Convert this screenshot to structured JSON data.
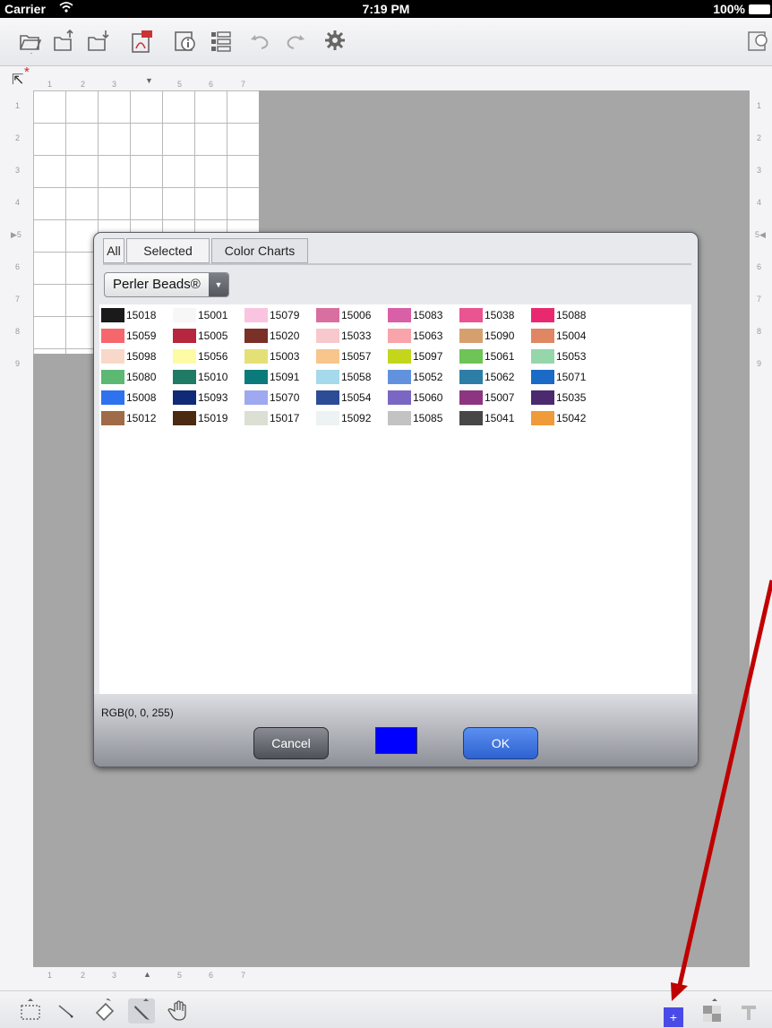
{
  "status_bar": {
    "carrier": "Carrier",
    "time": "7:19 PM",
    "battery": "100%"
  },
  "toolbar": {
    "icons": [
      "open-folder-icon",
      "import-icon",
      "export-icon",
      "pdf-export-icon",
      "info-icon",
      "list-icon",
      "undo-icon",
      "redo-icon",
      "settings-gear-icon",
      "zoom-icon"
    ]
  },
  "ruler": {
    "top_numbers": [
      "1",
      "2",
      "3",
      "4",
      "5",
      "6",
      "7"
    ],
    "left_numbers": [
      "1",
      "2",
      "3",
      "4",
      "5",
      "6",
      "7",
      "8",
      "9"
    ],
    "bottom_numbers": [
      "1",
      "2",
      "3",
      "4",
      "5",
      "6",
      "7"
    ],
    "right_numbers": [
      "1",
      "2",
      "3",
      "4",
      "5",
      "6",
      "7",
      "8",
      "9"
    ]
  },
  "dialog": {
    "tabs": [
      "All",
      "Selected",
      "Color Charts"
    ],
    "active_tab": "Color Charts",
    "chart_select": "Perler Beads®",
    "swatches": [
      [
        {
          "code": "15018",
          "color": "#1a1a1a"
        },
        {
          "code": "15001",
          "color": "#f7f7f7"
        },
        {
          "code": "15079",
          "color": "#f9c4e0"
        },
        {
          "code": "15006",
          "color": "#d86fa0"
        },
        {
          "code": "15083",
          "color": "#d95fa6"
        },
        {
          "code": "15038",
          "color": "#ea5490"
        },
        {
          "code": "15088",
          "color": "#e9296f"
        }
      ],
      [
        {
          "code": "15059",
          "color": "#f6666d"
        },
        {
          "code": "15005",
          "color": "#b6263e"
        },
        {
          "code": "15020",
          "color": "#7a2f27"
        },
        {
          "code": "15033",
          "color": "#f7c8cc"
        },
        {
          "code": "15063",
          "color": "#f8a4aa"
        },
        {
          "code": "15090",
          "color": "#d6a06e"
        },
        {
          "code": "15004",
          "color": "#df8662"
        }
      ],
      [
        {
          "code": "15098",
          "color": "#f8d8c8"
        },
        {
          "code": "15056",
          "color": "#fdfba4"
        },
        {
          "code": "15003",
          "color": "#e5e076"
        },
        {
          "code": "15057",
          "color": "#f8c58c"
        },
        {
          "code": "15097",
          "color": "#c4d61c"
        },
        {
          "code": "15061",
          "color": "#6ec456"
        },
        {
          "code": "15053",
          "color": "#95d6ab"
        }
      ],
      [
        {
          "code": "15080",
          "color": "#5db874"
        },
        {
          "code": "15010",
          "color": "#1f7b63"
        },
        {
          "code": "15091",
          "color": "#0a7a7b"
        },
        {
          "code": "15058",
          "color": "#a5d9ec"
        },
        {
          "code": "15052",
          "color": "#6292de"
        },
        {
          "code": "15062",
          "color": "#2d7ea6"
        },
        {
          "code": "15071",
          "color": "#1b6ac6"
        }
      ],
      [
        {
          "code": "15008",
          "color": "#2e72f0"
        },
        {
          "code": "15093",
          "color": "#102a78"
        },
        {
          "code": "15070",
          "color": "#9fa9ef"
        },
        {
          "code": "15054",
          "color": "#2c4c96"
        },
        {
          "code": "15060",
          "color": "#7a67c3"
        },
        {
          "code": "15007",
          "color": "#8c3580"
        },
        {
          "code": "15035",
          "color": "#4b2a70"
        }
      ],
      [
        {
          "code": "15012",
          "color": "#9f6c47"
        },
        {
          "code": "15019",
          "color": "#4a2a10"
        },
        {
          "code": "15017",
          "color": "#dcdfd3"
        },
        {
          "code": "15092",
          "color": "#ecf3f2"
        },
        {
          "code": "15085",
          "color": "#c3c3c3"
        },
        {
          "code": "15041",
          "color": "#474747"
        },
        {
          "code": "15042",
          "color": "#ef9b3a"
        }
      ]
    ],
    "rgb_readout": "RGB(0, 0, 255)",
    "preview_color": "#0000ff",
    "cancel_label": "Cancel",
    "ok_label": "OK"
  },
  "bottom_toolbar": {
    "tools": [
      "selection-icon",
      "eyedropper-icon",
      "eraser-icon",
      "pencil-icon",
      "hand-pan-icon"
    ],
    "current_color_symbol": "+",
    "current_color": "#4a4ae8"
  }
}
